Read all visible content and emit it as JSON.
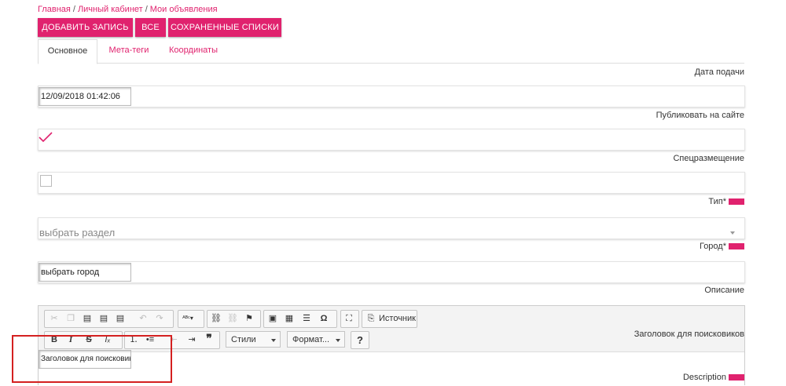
{
  "breadcrumb": {
    "items": [
      "Главная",
      "Личный кабинет",
      "Мои объявления"
    ],
    "separator": "/"
  },
  "toolbar": {
    "add_label": "Добавить запись",
    "all_label": "Все",
    "saved_label": "Сохраненные списки"
  },
  "tabs": [
    {
      "label": "Основное",
      "active": true
    },
    {
      "label": "Мета-теги",
      "active": false
    },
    {
      "label": "Координаты",
      "active": false
    }
  ],
  "form": {
    "date_label": "Дата подачи",
    "date_value": "12/09/2018 01:42:06",
    "publish_label": "Публиковать на сайте",
    "publish_checked": true,
    "special_label": "Спецразмещение",
    "special_checked": false,
    "type_label": "Тип*",
    "type_placeholder": "выбрать раздел",
    "city_label": "Город*",
    "city_placeholder": "выбрать город",
    "description_label": "Описание",
    "seo_title_label": "Заголовок для поисковиков",
    "seo_title_value": "Заголовок для поисковиков",
    "meta_description_label": "Description"
  },
  "editor": {
    "source_label": "Источник",
    "styles_label": "Стили",
    "format_label": "Формат...",
    "help_label": "?"
  },
  "colors": {
    "accent": "#e0226e",
    "highlight_box": "#d42020"
  }
}
